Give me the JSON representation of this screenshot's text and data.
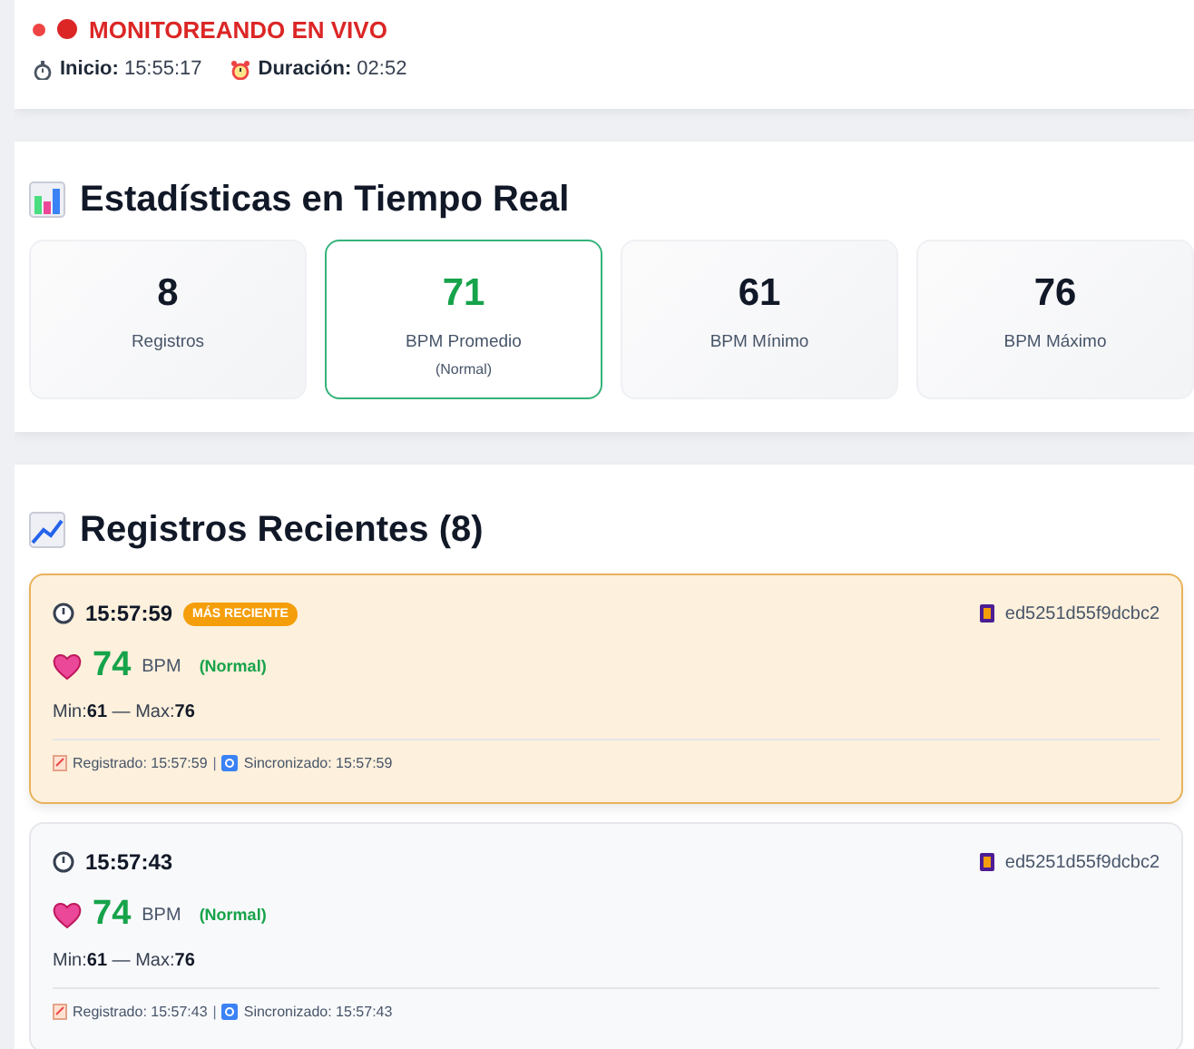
{
  "status": {
    "live": true,
    "label": "MONITOREANDO EN VIVO"
  },
  "session": [
    {
      "kind": "start",
      "label": "Inicio:",
      "value": "15:55:17"
    },
    {
      "kind": "duration",
      "label": "Duración:",
      "value": "02:52"
    }
  ],
  "stats": {
    "title": "Estadísticas en Tiempo Real",
    "cards": [
      {
        "value": "8",
        "label": "Registros",
        "highlighted": false
      },
      {
        "value": "71",
        "label": "BPM Promedio",
        "note": "(Normal)",
        "highlighted": true
      },
      {
        "value": "61",
        "label": "BPM Mínimo",
        "highlighted": false
      },
      {
        "value": "76",
        "label": "BPM Máximo",
        "highlighted": false
      }
    ]
  },
  "records": {
    "title": "Registros Recientes (8)",
    "items": [
      {
        "time": "15:57:59",
        "latest": true,
        "badge": "MÁS RECIENTE",
        "id": "ed5251d55f9dcbc2",
        "bpm": "74",
        "unit": "BPM",
        "state": "(Normal)",
        "range": "Min:**61** — Max:**76**",
        "registered": "Registrado: 15:57:59",
        "separator": "|",
        "synced": "Sincronizado: 15:57:59"
      },
      {
        "time": "15:57:43",
        "latest": false,
        "id": "ed5251d55f9dcbc2",
        "bpm": "74",
        "unit": "BPM",
        "state": "(Normal)",
        "range": "Min:**61** — Max:**76**",
        "registered": "Registrado: 15:57:43",
        "separator": "|",
        "synced": "Sincronizado: 15:57:43"
      }
    ]
  }
}
